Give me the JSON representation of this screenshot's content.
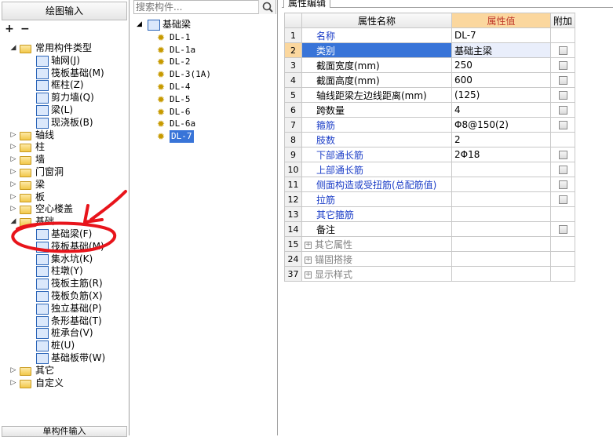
{
  "left": {
    "title": "绘图输入",
    "toolbar": {
      "expand": "+",
      "collapse": "−"
    },
    "bottom_tab": "单构件输入",
    "tree": [
      {
        "label": "常用构件类型",
        "kind": "folder",
        "level": 0,
        "expanded": true
      },
      {
        "label": "轴网(J)",
        "kind": "comp",
        "level": 1
      },
      {
        "label": "筏板基础(M)",
        "kind": "comp",
        "level": 1
      },
      {
        "label": "框柱(Z)",
        "kind": "comp",
        "level": 1
      },
      {
        "label": "剪力墙(Q)",
        "kind": "comp",
        "level": 1
      },
      {
        "label": "梁(L)",
        "kind": "comp",
        "level": 1
      },
      {
        "label": "现浇板(B)",
        "kind": "comp",
        "level": 1
      },
      {
        "label": "轴线",
        "kind": "folder",
        "level": 0,
        "expanded": false
      },
      {
        "label": "柱",
        "kind": "folder",
        "level": 0,
        "expanded": false
      },
      {
        "label": "墙",
        "kind": "folder",
        "level": 0,
        "expanded": false
      },
      {
        "label": "门窗洞",
        "kind": "folder",
        "level": 0,
        "expanded": false
      },
      {
        "label": "梁",
        "kind": "folder",
        "level": 0,
        "expanded": false
      },
      {
        "label": "板",
        "kind": "folder",
        "level": 0,
        "expanded": false
      },
      {
        "label": "空心楼盖",
        "kind": "folder",
        "level": 0,
        "expanded": false
      },
      {
        "label": "基础",
        "kind": "folder",
        "level": 0,
        "expanded": true
      },
      {
        "label": "基础梁(F)",
        "kind": "comp",
        "level": 1
      },
      {
        "label": "筏板基础(M)",
        "kind": "comp",
        "level": 1
      },
      {
        "label": "集水坑(K)",
        "kind": "comp",
        "level": 1
      },
      {
        "label": "柱墩(Y)",
        "kind": "comp",
        "level": 1
      },
      {
        "label": "筏板主筋(R)",
        "kind": "comp",
        "level": 1
      },
      {
        "label": "筏板负筋(X)",
        "kind": "comp",
        "level": 1
      },
      {
        "label": "独立基础(P)",
        "kind": "comp",
        "level": 1
      },
      {
        "label": "条形基础(T)",
        "kind": "comp",
        "level": 1
      },
      {
        "label": "桩承台(V)",
        "kind": "comp",
        "level": 1
      },
      {
        "label": "桩(U)",
        "kind": "comp",
        "level": 1
      },
      {
        "label": "基础板带(W)",
        "kind": "comp",
        "level": 1
      },
      {
        "label": "其它",
        "kind": "folder",
        "level": 0,
        "expanded": false
      },
      {
        "label": "自定义",
        "kind": "folder",
        "level": 0,
        "expanded": false
      }
    ]
  },
  "middle": {
    "search_placeholder": "搜索构件...",
    "root_label": "基础梁",
    "items": [
      "DL-1",
      "DL-1a",
      "DL-2",
      "DL-3(1A)",
      "DL-4",
      "DL-5",
      "DL-6",
      "DL-6a",
      "DL-7"
    ],
    "selected_item": "DL-7"
  },
  "right": {
    "tab_label": "属性编辑",
    "headers": {
      "name": "属性名称",
      "value": "属性值",
      "extra": "附加"
    },
    "rows": [
      {
        "no": "1",
        "name": "名称",
        "value": "DL-7",
        "checkbox": false,
        "color": "blue"
      },
      {
        "no": "2",
        "name": "类别",
        "value": "基础主梁",
        "checkbox": true,
        "color": "blue",
        "selected": true
      },
      {
        "no": "3",
        "name": "截面宽度(mm)",
        "value": "250",
        "checkbox": true,
        "color": "black"
      },
      {
        "no": "4",
        "name": "截面高度(mm)",
        "value": "600",
        "checkbox": true,
        "color": "black"
      },
      {
        "no": "5",
        "name": "轴线距梁左边线距离(mm)",
        "value": "(125)",
        "checkbox": true,
        "color": "black"
      },
      {
        "no": "6",
        "name": "跨数量",
        "value": "4",
        "checkbox": true,
        "color": "black"
      },
      {
        "no": "7",
        "name": "箍筋",
        "value": "Φ8@150(2)",
        "checkbox": true,
        "color": "blue"
      },
      {
        "no": "8",
        "name": "肢数",
        "value": "2",
        "checkbox": false,
        "color": "blue"
      },
      {
        "no": "9",
        "name": "下部通长筋",
        "value": "2Φ18",
        "checkbox": true,
        "color": "blue"
      },
      {
        "no": "10",
        "name": "上部通长筋",
        "value": "",
        "checkbox": true,
        "color": "blue"
      },
      {
        "no": "11",
        "name": "侧面构造或受扭筋(总配筋值)",
        "value": "",
        "checkbox": true,
        "color": "blue"
      },
      {
        "no": "12",
        "name": "拉筋",
        "value": "",
        "checkbox": true,
        "color": "blue"
      },
      {
        "no": "13",
        "name": "其它箍筋",
        "value": "",
        "checkbox": false,
        "color": "blue"
      },
      {
        "no": "14",
        "name": "备注",
        "value": "",
        "checkbox": true,
        "color": "black"
      },
      {
        "no": "15",
        "name": "其它属性",
        "value": "",
        "checkbox": false,
        "color": "gray",
        "group": true
      },
      {
        "no": "24",
        "name": "锚固搭接",
        "value": "",
        "checkbox": false,
        "color": "gray",
        "group": true
      },
      {
        "no": "37",
        "name": "显示样式",
        "value": "",
        "checkbox": false,
        "color": "gray",
        "group": true
      }
    ]
  },
  "colors": {
    "selection": "#3874d8",
    "header_highlight": "#fbd79e",
    "blue_text": "#1c3ec7",
    "annotation": "#e8141b"
  }
}
